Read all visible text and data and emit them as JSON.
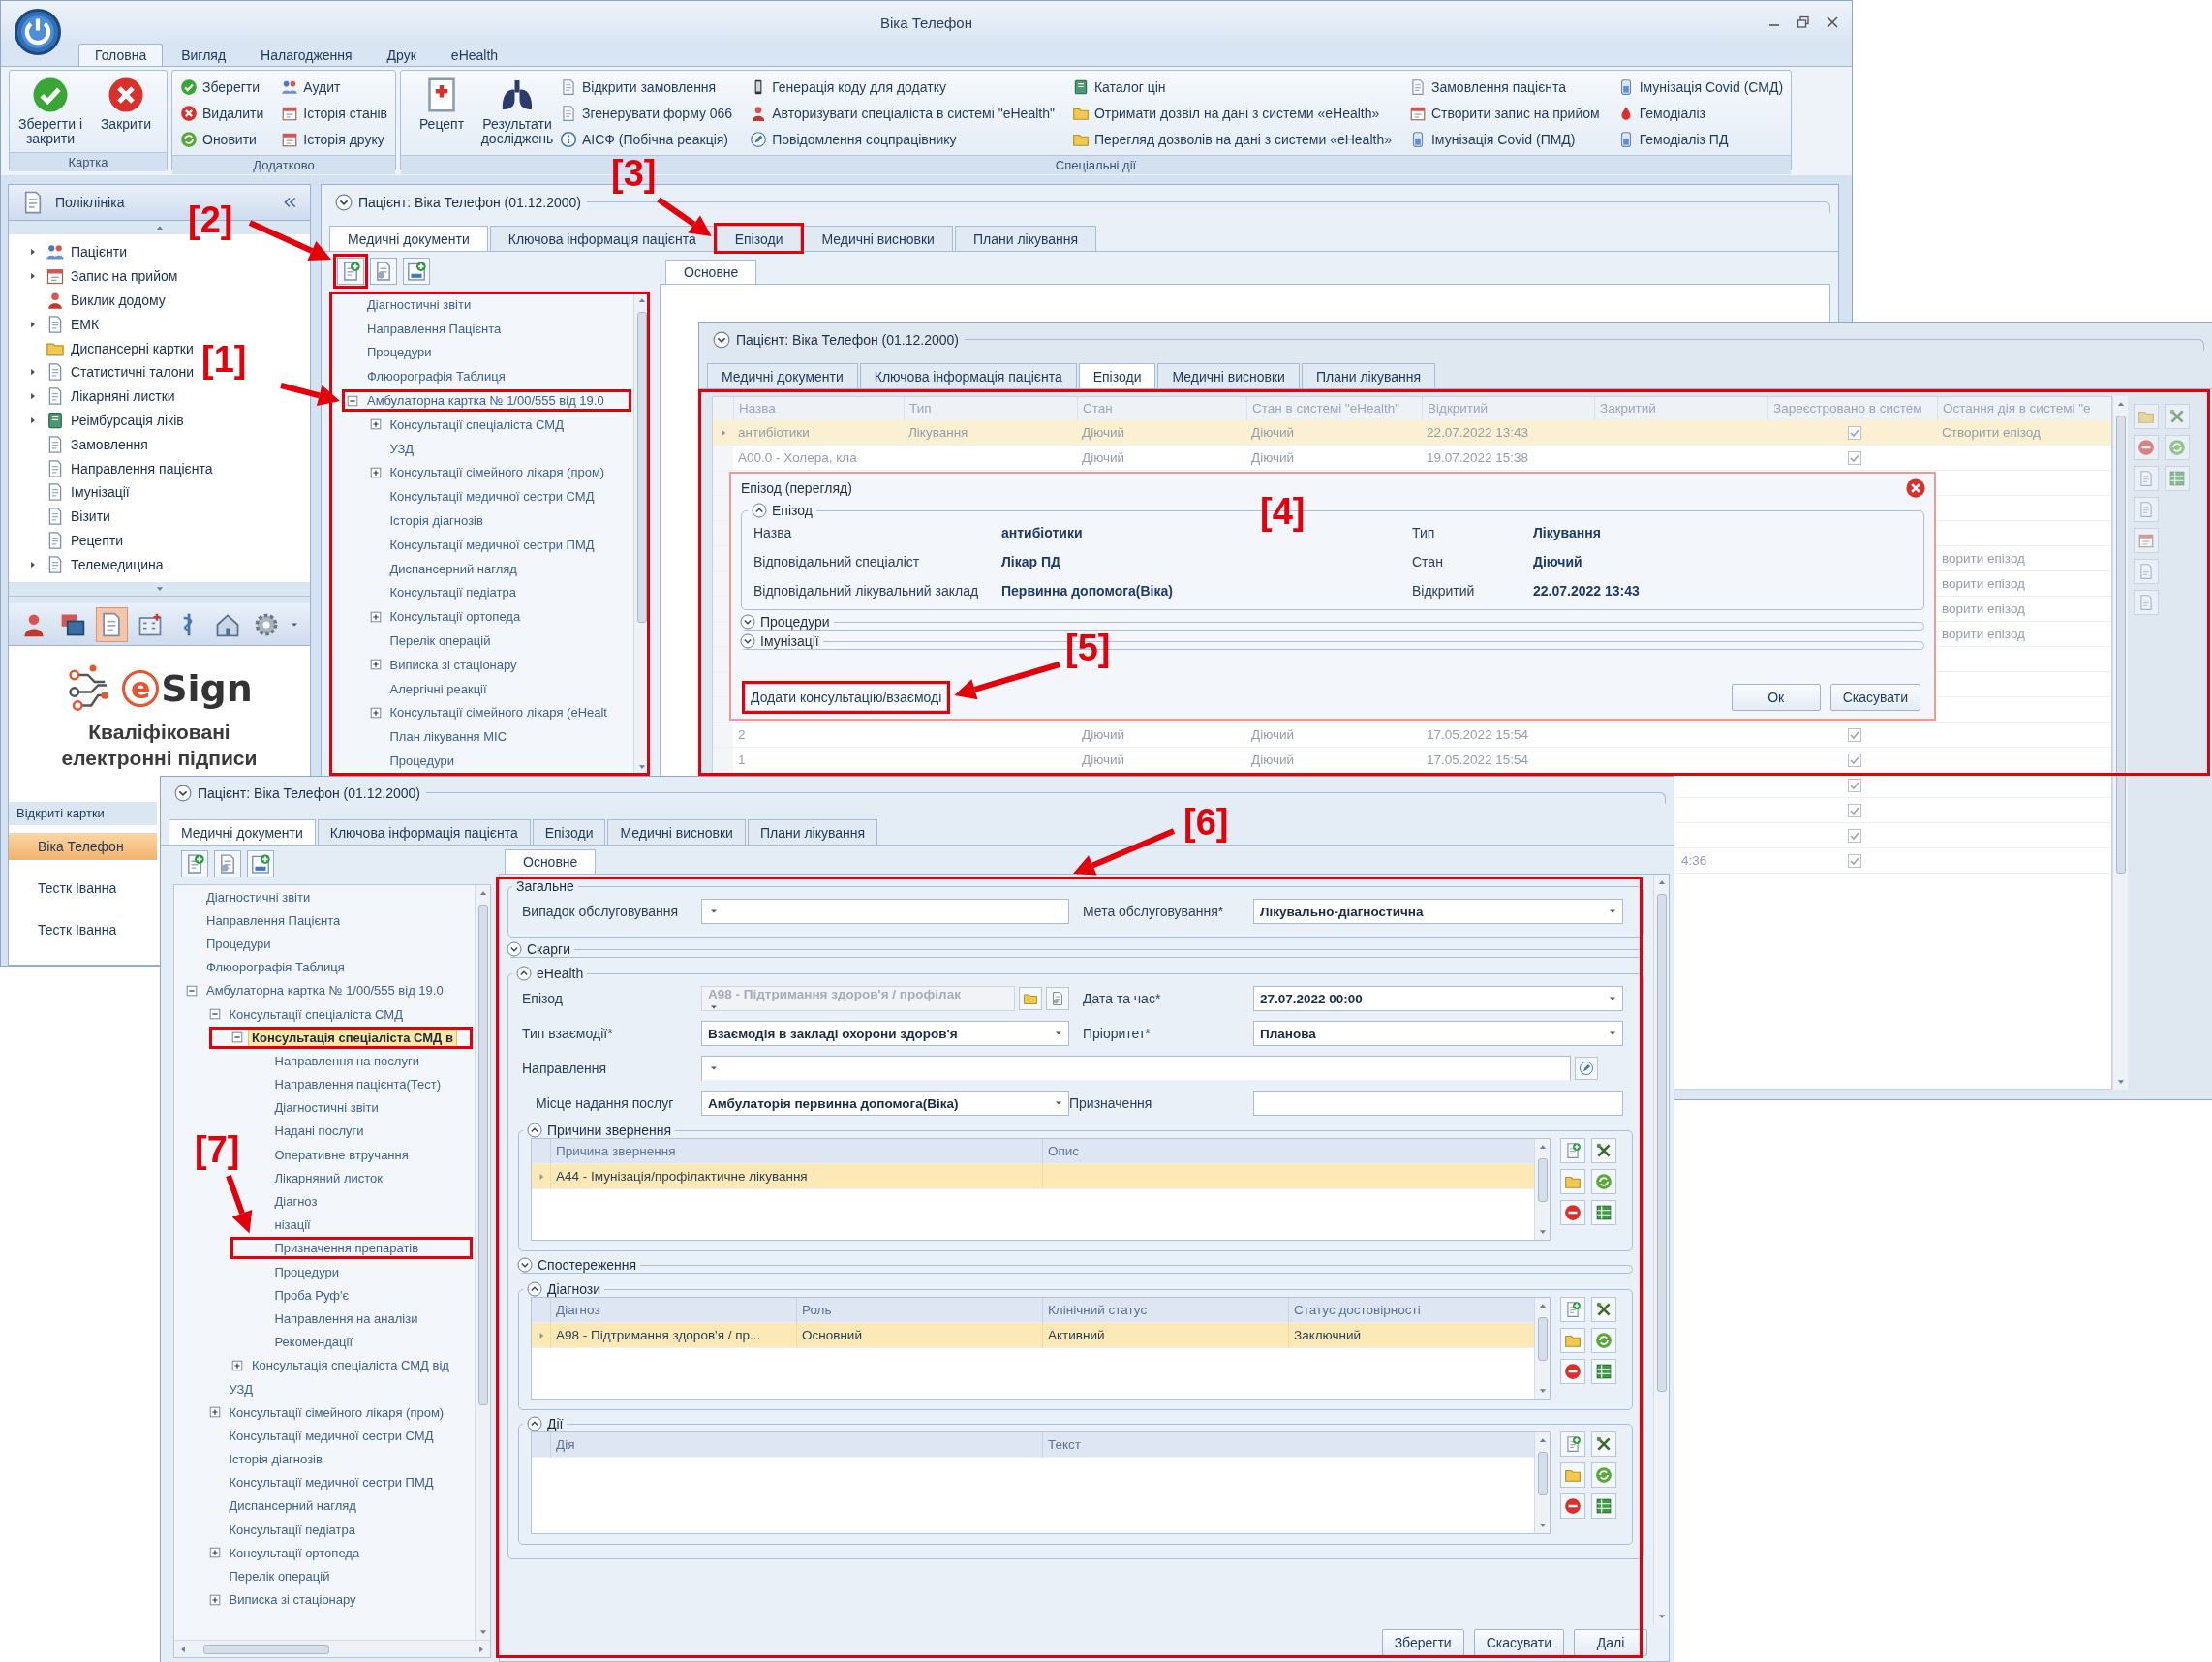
{
  "main_window": {
    "title": "Віка Телефон",
    "ribbon_tabs": [
      {
        "label": "Головна",
        "selected": true
      },
      {
        "label": "Вигляд",
        "selected": false
      },
      {
        "label": "Налагодження",
        "selected": false
      },
      {
        "label": "Друк",
        "selected": false
      },
      {
        "label": "eHealth",
        "selected": false
      }
    ],
    "ribbon_groups": [
      {
        "label": "Картка",
        "large_buttons": [
          "Зберегти і закрити",
          "Закрити"
        ]
      },
      {
        "label": "Додатково",
        "small_buttons": [
          "Зберегти",
          "Видалити",
          "Оновити",
          "Аудит",
          "Історія станів",
          "Історія друку"
        ]
      },
      {
        "label": "Спеціальні дії",
        "large_buttons": [
          "Рецепт",
          "Результати досліджень"
        ],
        "small_buttons": [
          "Відкрити замовлення",
          "Згенерувати форму 066",
          "АІСФ (Побічна реакція)",
          "Генерація коду для додатку",
          "Авторизувати спеціаліста в системі \"eHealth\"",
          "Повідомлення соцпрацівнику",
          "Каталог цін",
          "Отримати дозвіл на дані з системи «eHealth»",
          "Перегляд дозволів на дані з системи «eHealth»",
          "Замовлення пацієнта",
          "Створити запис на прийом",
          "Імунізація Covid (ПМД)",
          "Імунізація Covid (СМД)",
          "Гемодіаліз",
          "Гемодіаліз ПД"
        ]
      }
    ],
    "navigation": {
      "title": "Поліклініка",
      "items": [
        {
          "label": "Пацієнти",
          "expandable": true
        },
        {
          "label": "Запис на прийом",
          "expandable": true
        },
        {
          "label": "Виклик додому",
          "expandable": false
        },
        {
          "label": "ЕМК",
          "expandable": true
        },
        {
          "label": "Диспансерні картки",
          "expandable": false
        },
        {
          "label": "Статистичні талони",
          "expandable": true
        },
        {
          "label": "Лікарняні листки",
          "expandable": true
        },
        {
          "label": "Реімбурсація ліків",
          "expandable": true
        },
        {
          "label": "Замовлення",
          "expandable": false
        },
        {
          "label": "Направлення пацієнта",
          "expandable": false
        },
        {
          "label": "Імунізації",
          "expandable": false
        },
        {
          "label": "Візити",
          "expandable": false
        },
        {
          "label": "Рецепти",
          "expandable": false
        },
        {
          "label": "Телемедицина",
          "expandable": true
        }
      ]
    },
    "shortcuts": [
      {
        "selected": false
      },
      {
        "selected": false
      },
      {
        "selected": true
      },
      {
        "selected": false
      },
      {
        "selected": false
      },
      {
        "selected": false
      },
      {
        "selected": false
      }
    ],
    "logo": {
      "mark": "e",
      "text": "Sign",
      "caption": "Кваліфіковані електронні підписи"
    },
    "open_cards": {
      "title": "Відкриті картки",
      "items": [
        {
          "label": "Віка Телефон",
          "selected": true
        },
        {
          "label": "Тестк Іванна",
          "selected": false
        },
        {
          "label": "Тестк Іванна",
          "selected": false
        }
      ]
    },
    "patient_view": {
      "header": {
        "title": "Пацієнт: Віка Телефон (01.12.2000)",
        "expanded": false
      },
      "tabs": [
        {
          "label": "Медичні документи",
          "selected": true
        },
        {
          "label": "Ключова інформація пацієнта",
          "selected": false
        },
        {
          "label": "Епізоди",
          "selected": false
        },
        {
          "label": "Медичні висновки",
          "selected": false
        },
        {
          "label": "Плани лікування",
          "selected": false
        }
      ],
      "tree": [
        {
          "label": "Діагностичні звіти",
          "kind": "leaf",
          "selected": false
        },
        {
          "label": "Направлення Пацієнта",
          "kind": "leaf",
          "selected": false
        },
        {
          "label": "Процедури",
          "kind": "leaf",
          "selected": false
        },
        {
          "label": "Флюорографія Таблиця",
          "kind": "leaf",
          "selected": false
        },
        {
          "label": "Амбулаторна картка № 1/00/555 від 19.0",
          "kind": "branch",
          "expanded": true,
          "selected": false,
          "children": [
            {
              "label": "Консультації спеціаліста СМД",
              "kind": "branch",
              "expanded": false,
              "selected": false
            },
            {
              "label": "УЗД",
              "kind": "leaf",
              "selected": false
            },
            {
              "label": "Консультації сімейного лікаря (пром)",
              "kind": "branch",
              "expanded": false,
              "selected": false
            },
            {
              "label": "Консультації медичної сестри СМД",
              "kind": "leaf",
              "selected": false
            },
            {
              "label": "Історія діагнозів",
              "kind": "leaf",
              "selected": false
            },
            {
              "label": "Консультації медичної сестри ПМД",
              "kind": "leaf",
              "selected": false
            },
            {
              "label": "Диспансерний нагляд",
              "kind": "leaf",
              "selected": false
            },
            {
              "label": "Консультації педіатра",
              "kind": "leaf",
              "selected": false
            },
            {
              "label": "Консультації ортопеда",
              "kind": "branch",
              "expanded": false,
              "selected": false
            },
            {
              "label": "Перелік операцій",
              "kind": "leaf",
              "selected": false
            },
            {
              "label": "Виписка зі стаціонару",
              "kind": "branch",
              "expanded": false,
              "selected": false
            },
            {
              "label": "Алергічні реакції",
              "kind": "leaf",
              "selected": false
            },
            {
              "label": "Консультації сімейного лікаря (eHealt",
              "kind": "branch",
              "expanded": false,
              "selected": false
            },
            {
              "label": "План лікування МІС",
              "kind": "leaf",
              "selected": false
            },
            {
              "label": "Процедури",
              "kind": "leaf",
              "selected": false
            }
          ]
        }
      ],
      "subtabs": [
        {
          "label": "Основне",
          "selected": true
        }
      ]
    }
  },
  "episodes_window": {
    "header": {
      "title": "Пацієнт: Віка Телефон (01.12.2000)",
      "expanded": false
    },
    "tabs": [
      {
        "label": "Медичні документи",
        "selected": false
      },
      {
        "label": "Ключова інформація пацієнта",
        "selected": false
      },
      {
        "label": "Епізоди",
        "selected": true
      },
      {
        "label": "Медичні висновки",
        "selected": false
      },
      {
        "label": "Плани лікування",
        "selected": false
      }
    ],
    "table": {
      "columns": [
        "Назва",
        "Тип",
        "Стан",
        "Стан в системі \"eHealth\"",
        "Відкритий",
        "Закритий",
        "Зареєстровано в систем",
        "Остання дія в системі \"е"
      ],
      "rows": [
        {
          "selected": true,
          "name": "антибіотики",
          "type": "Лікування",
          "state": "Діючий",
          "ehealth_state": "Діючий",
          "opened": "22.07.2022 13:43",
          "registered": true,
          "last_action": "Створити епізод"
        },
        {
          "selected": false,
          "name": "A00.0 - Холера, кла",
          "state": "Діючий",
          "ehealth_state": "Діючий",
          "opened": "19.07.2022 15:38",
          "registered": true
        },
        {
          "selected": false
        },
        {
          "selected": false
        },
        {
          "selected": false
        },
        {
          "selected": false,
          "last_action": "ворити епізод"
        },
        {
          "selected": false,
          "last_action": "ворити епізод"
        },
        {
          "selected": false,
          "last_action": "ворити епізод"
        },
        {
          "selected": false,
          "last_action": "ворити епізод"
        },
        {
          "selected": false
        },
        {
          "selected": false
        },
        {
          "selected": false
        },
        {
          "selected": false,
          "name": "2",
          "state": "Діючий",
          "ehealth_state": "Діючий",
          "opened": "17.05.2022 15:54",
          "registered": true
        },
        {
          "selected": false,
          "name": "1",
          "state": "Діючий",
          "ehealth_state": "Діючий",
          "opened": "17.05.2022 15:54",
          "registered": true
        },
        {
          "selected": false,
          "registered": true
        },
        {
          "selected": false,
          "registered": true
        },
        {
          "selected": false,
          "registered": true
        },
        {
          "selected": false,
          "closed": "4:36",
          "registered": true
        }
      ]
    }
  },
  "episode_dialog": {
    "title": "Епізод (перегляд)",
    "groups": [
      {
        "title": "Епізод",
        "expanded": true,
        "fields": [
          {
            "label": "Назва",
            "value": "антибіотики"
          },
          {
            "label": "Тип",
            "value": "Лікування"
          },
          {
            "label": "Відповідальний спеціаліст",
            "value": "Лікар ПД"
          },
          {
            "label": "Стан",
            "value": "Діючий"
          },
          {
            "label": "Відповідальний лікувальний заклад",
            "value": "Первинна допомога(Віка)"
          },
          {
            "label": "Відкритий",
            "value": "22.07.2022 13:43"
          }
        ]
      },
      {
        "title": "Процедури",
        "expanded": false
      },
      {
        "title": "Імунізації",
        "expanded": false
      }
    ],
    "add_button": "Додати консультацію/взаємоді",
    "buttons": [
      "Ок",
      "Скасувати"
    ]
  },
  "consultation_window": {
    "header": {
      "title": "Пацієнт: Віка Телефон (01.12.2000)",
      "expanded": false
    },
    "tabs": [
      {
        "label": "Медичні документи",
        "selected": true
      },
      {
        "label": "Ключова інформація пацієнта",
        "selected": false
      },
      {
        "label": "Епізоди",
        "selected": false
      },
      {
        "label": "Медичні висновки",
        "selected": false
      },
      {
        "label": "Плани лікування",
        "selected": false
      }
    ],
    "tree": [
      {
        "label": "Діагностичні звіти",
        "kind": "leaf",
        "selected": false
      },
      {
        "label": "Направлення Пацієнта",
        "kind": "leaf",
        "selected": false
      },
      {
        "label": "Процедури",
        "kind": "leaf",
        "selected": false
      },
      {
        "label": "Флюорографія Таблиця",
        "kind": "leaf",
        "selected": false
      },
      {
        "label": "Амбулаторна картка № 1/00/555 від 19.0",
        "kind": "branch",
        "expanded": true,
        "selected": false,
        "children": [
          {
            "label": "Консультації спеціаліста СМД",
            "kind": "branch",
            "expanded": true,
            "selected": false,
            "children": [
              {
                "label": "Консультація спеціаліста СМД в",
                "kind": "branch",
                "expanded": true,
                "selected": true,
                "children": [
                  {
                    "label": "Направлення на послуги",
                    "kind": "leaf",
                    "selected": false
                  },
                  {
                    "label": "Направлення пацієнта(Тест)",
                    "kind": "leaf",
                    "selected": false
                  },
                  {
                    "label": "Діагностичні звіти",
                    "kind": "leaf",
                    "selected": false
                  },
                  {
                    "label": "Надані послуги",
                    "kind": "leaf",
                    "selected": false
                  },
                  {
                    "label": "Оперативне втручання",
                    "kind": "leaf",
                    "selected": false
                  },
                  {
                    "label": "Лікарняний листок",
                    "kind": "leaf",
                    "selected": false
                  },
                  {
                    "label": "Діагноз",
                    "kind": "leaf",
                    "selected": false
                  },
                  {
                    "label": "нізації",
                    "kind": "leaf",
                    "selected": false
                  },
                  {
                    "label": "Призначення препаратів",
                    "kind": "leaf",
                    "selected": false
                  },
                  {
                    "label": "Процедури",
                    "kind": "leaf",
                    "selected": false
                  },
                  {
                    "label": "Проба Руф'є",
                    "kind": "leaf",
                    "selected": false
                  },
                  {
                    "label": "Направлення на аналізи",
                    "kind": "leaf",
                    "selected": false
                  },
                  {
                    "label": "Рекомендації",
                    "kind": "leaf",
                    "selected": false
                  }
                ]
              },
              {
                "label": "Консультація спеціаліста СМД від",
                "kind": "branch",
                "expanded": false,
                "selected": false
              }
            ]
          },
          {
            "label": "УЗД",
            "kind": "leaf",
            "selected": false
          },
          {
            "label": "Консультації сімейного лікаря (пром)",
            "kind": "branch",
            "expanded": false,
            "selected": false
          },
          {
            "label": "Консультації медичної сестри СМД",
            "kind": "leaf",
            "selected": false
          },
          {
            "label": "Історія діагнозів",
            "kind": "leaf",
            "selected": false
          },
          {
            "label": "Консультації медичної сестри ПМД",
            "kind": "leaf",
            "selected": false
          },
          {
            "label": "Диспансерний нагляд",
            "kind": "leaf",
            "selected": false
          },
          {
            "label": "Консультації педіатра",
            "kind": "leaf",
            "selected": false
          },
          {
            "label": "Консультації ортопеда",
            "kind": "branch",
            "expanded": false,
            "selected": false
          },
          {
            "label": "Перелік операцій",
            "kind": "leaf",
            "selected": false
          },
          {
            "label": "Виписка зі стаціонару",
            "kind": "branch",
            "expanded": false,
            "selected": false
          }
        ]
      }
    ],
    "subtabs": [
      {
        "label": "Основне",
        "selected": true
      }
    ],
    "form": {
      "sections": [
        {
          "title": "Загальне",
          "kind": "group",
          "fields": [
            {
              "label": "Випадок обслуговування",
              "kind": "dropdown"
            },
            {
              "label": "Мета обслуговування*",
              "kind": "dropdown",
              "value": "Лікувально-діагностична"
            }
          ]
        },
        {
          "title": "Скарги",
          "kind": "collapsible",
          "expanded": false
        },
        {
          "title": "eHealth",
          "kind": "collapsible",
          "expanded": true,
          "fields": [
            {
              "label": "Епізод",
              "kind": "lookup",
              "value": "A98 - Підтримання здоров'я / профілак",
              "disabled": true
            },
            {
              "label": "Дата та час*",
              "kind": "dropdown",
              "value": "27.07.2022 00:00"
            },
            {
              "label": "Тип взаємодії*",
              "kind": "dropdown",
              "value": "Взаємодія в закладі охорони здоров'я"
            },
            {
              "label": "Пріоритет*",
              "kind": "dropdown",
              "value": "Планова"
            },
            {
              "label": "Направлення",
              "kind": "wide_lookup"
            },
            {
              "label": "Місце надання послуг",
              "kind": "dropdown",
              "value": "Амбулаторія первинна допомога(Віка)"
            },
            {
              "label": "Призначення",
              "kind": "text"
            }
          ],
          "subsections": [
            {
              "title": "Причини звернення",
              "kind": "grid",
              "expanded": true,
              "columns": [
                "Причина звернення",
                "Опис"
              ],
              "rows": [
                {
                  "selected": true,
                  "cells": [
                    "A44 - Імунізація/профілактичне лікування"
                  ]
                }
              ]
            },
            {
              "title": "Спостереження",
              "kind": "collapsible",
              "expanded": false
            },
            {
              "title": "Діагнози",
              "kind": "grid",
              "expanded": true,
              "columns": [
                "Діагноз",
                "Роль",
                "Клінічний статус",
                "Статус достовірності"
              ],
              "rows": [
                {
                  "selected": true,
                  "cells": [
                    "A98 - Підтримання здоров'я / пр...",
                    "Основний",
                    "Активний",
                    "Заключний"
                  ]
                }
              ]
            },
            {
              "title": "Дії",
              "kind": "grid",
              "expanded": true,
              "columns": [
                "Дія",
                "Текст"
              ]
            }
          ]
        }
      ],
      "buttons": [
        "Зберегти",
        "Скасувати",
        "Далі"
      ]
    }
  },
  "annotations": [
    "[3]",
    "[2]",
    "[1]",
    "[4]",
    "[5]",
    "[6]",
    "[7]"
  ]
}
